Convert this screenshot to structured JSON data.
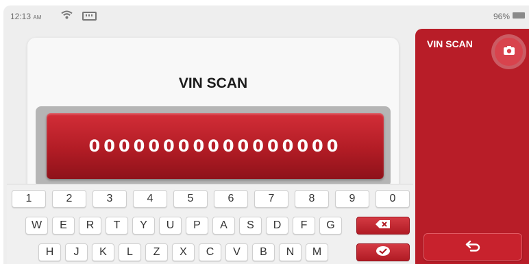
{
  "status_bar": {
    "time": "12:13",
    "ampm": "AM",
    "battery": "96%"
  },
  "main": {
    "title": "VIN SCAN",
    "vin_value": "00000000000000000"
  },
  "side_panel": {
    "title": "VIN SCAN"
  },
  "keyboard": {
    "row1": [
      "1",
      "2",
      "3",
      "4",
      "5",
      "6",
      "7",
      "8",
      "9",
      "0"
    ],
    "row2": [
      "W",
      "E",
      "R",
      "T",
      "Y",
      "U",
      "P",
      "A",
      "S",
      "D",
      "F",
      "G"
    ],
    "row3": [
      "H",
      "J",
      "K",
      "L",
      "Z",
      "X",
      "C",
      "V",
      "B",
      "N",
      "M"
    ]
  },
  "icons": {
    "wifi": "wifi-icon",
    "sim": "sim-card-icon",
    "battery": "battery-icon",
    "camera": "camera-icon",
    "backspace": "backspace-icon",
    "confirm": "check-icon",
    "back": "back-arrow-icon"
  },
  "colors": {
    "accent_red": "#b81d28",
    "vin_box": "#b21c25",
    "background": "#eeeeee"
  }
}
